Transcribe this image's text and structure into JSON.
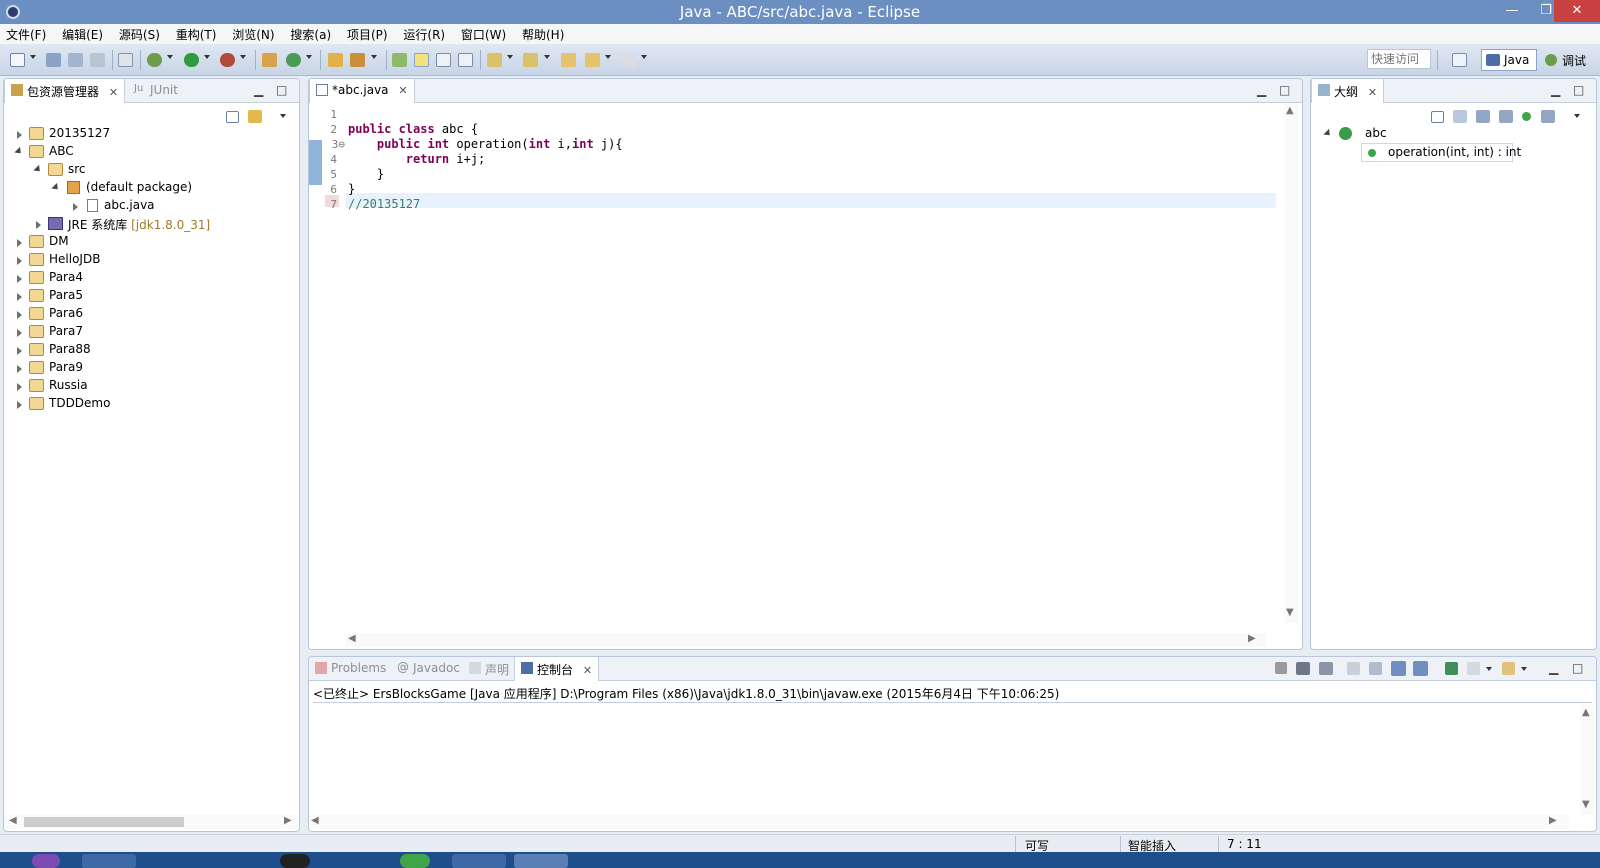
{
  "window": {
    "title": "Java - ABC/src/abc.java - Eclipse",
    "min": "—",
    "max": "❐",
    "close": "✕"
  },
  "menu": [
    "文件(F)",
    "编辑(E)",
    "源码(S)",
    "重构(T)",
    "浏览(N)",
    "搜索(a)",
    "项目(P)",
    "运行(R)",
    "窗口(W)",
    "帮助(H)"
  ],
  "toolbar": {
    "quick_access": "快速访问",
    "perspective_java": "Java",
    "perspective_debug": "调试"
  },
  "left_panel": {
    "tabs": [
      {
        "label": "包资源管理器",
        "close": "✕"
      },
      {
        "label": "JUnit"
      }
    ],
    "tree": [
      {
        "label": "20135127"
      },
      {
        "label": "ABC"
      },
      {
        "label": "src"
      },
      {
        "label": "(default package)"
      },
      {
        "label": "abc.java"
      },
      {
        "label": "JRE 系统库",
        "decoration": "[jdk1.8.0_31]"
      },
      {
        "label": "DM"
      },
      {
        "label": "HelloJDB"
      },
      {
        "label": "Para4"
      },
      {
        "label": "Para5"
      },
      {
        "label": "Para6"
      },
      {
        "label": "Para7"
      },
      {
        "label": "Para88"
      },
      {
        "label": "Para9"
      },
      {
        "label": "Russia"
      },
      {
        "label": "TDDDemo"
      }
    ]
  },
  "editor": {
    "tab": "*abc.java",
    "close": "✕",
    "lines": [
      {
        "n": "1",
        "parts": []
      },
      {
        "n": "2",
        "parts": [
          {
            "t": "public class",
            "k": "kw"
          },
          {
            "t": " abc {",
            "k": ""
          }
        ]
      },
      {
        "n": "3⊖",
        "parts": [
          {
            "t": "    public int",
            "k": "kw"
          },
          {
            "t": " operation(",
            "k": ""
          },
          {
            "t": "int",
            "k": "kw"
          },
          {
            "t": " i,",
            "k": ""
          },
          {
            "t": "int",
            "k": "kw"
          },
          {
            "t": " j){",
            "k": ""
          }
        ]
      },
      {
        "n": "4",
        "parts": [
          {
            "t": "        return",
            "k": "kw"
          },
          {
            "t": " i+j;",
            "k": ""
          }
        ]
      },
      {
        "n": "5",
        "parts": [
          {
            "t": "    }",
            "k": ""
          }
        ]
      },
      {
        "n": "6",
        "parts": [
          {
            "t": "}",
            "k": ""
          }
        ]
      },
      {
        "n": "7",
        "parts": [
          {
            "t": "//20135127",
            "k": "cm"
          }
        ]
      }
    ]
  },
  "outline": {
    "tab": "大纲",
    "close": "✕",
    "class_name": "abc",
    "method": "operation(int, int) : int"
  },
  "console": {
    "tabs": [
      "Problems",
      "Javadoc",
      "声明",
      "控制台"
    ],
    "close": "✕",
    "header": "<已终止> ErsBlocksGame [Java 应用程序] D:\\Program Files (x86)\\Java\\jdk1.8.0_31\\bin\\javaw.exe (2015年6月4日 下午10:06:25)"
  },
  "status": {
    "writable": "可写",
    "insert_mode": "智能插入",
    "position": "7 : 11"
  },
  "colors": {
    "titlebar": "#6b8fc1",
    "toolbar": "#c8d5e6",
    "keyword": "#7f0055",
    "comment": "#3f7f5f",
    "current_line": "#e8f2fe"
  }
}
